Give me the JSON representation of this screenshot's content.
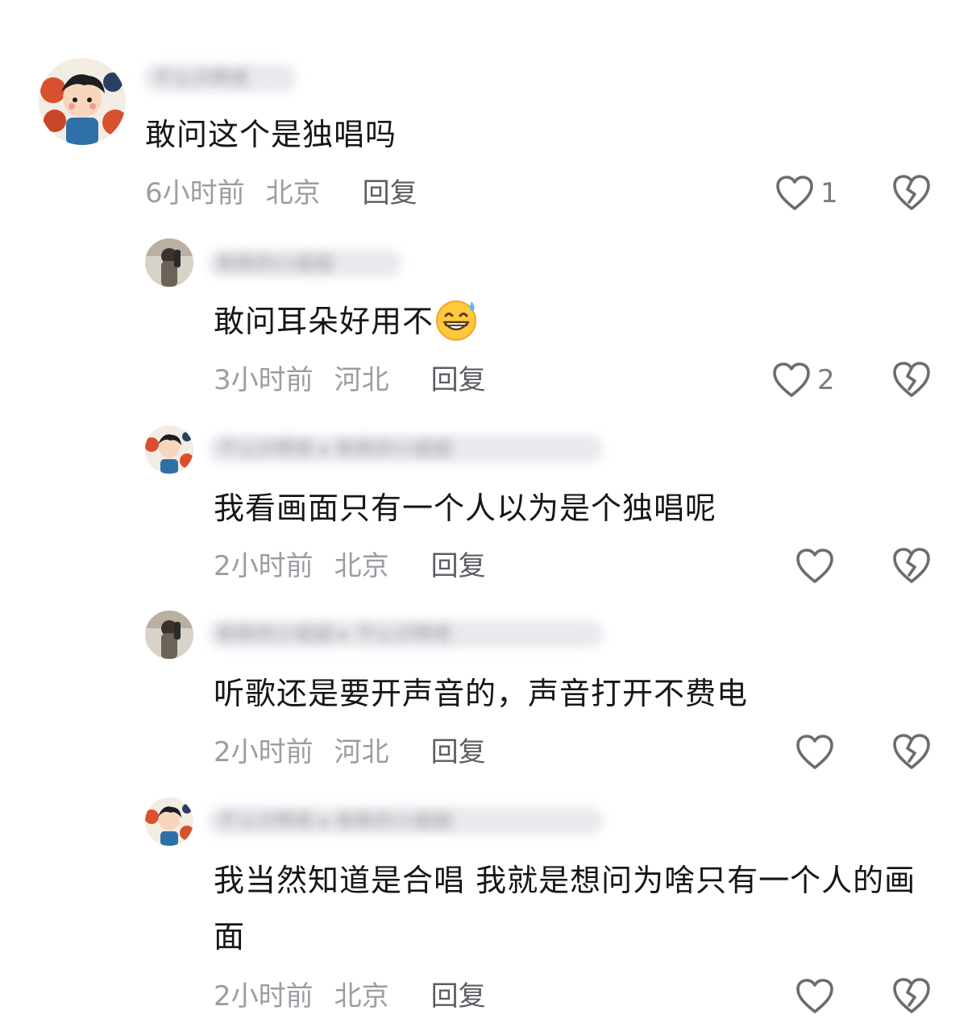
{
  "comments": [
    {
      "username": "不认识啊老",
      "text": "敢问这个是独唱吗",
      "time": "6小时前",
      "location": "北京",
      "reply_label": "回复",
      "likes": "1"
    },
    {
      "username": "新新的小姐姐",
      "text": "敢问耳朵好用不",
      "emoji": "sweat-grin-emoji",
      "time": "3小时前",
      "location": "河北",
      "reply_label": "回复",
      "likes": "2"
    },
    {
      "username": "不认识啊老 ▸ 新新的小姐姐",
      "text": "我看画面只有一个人以为是个独唱呢",
      "time": "2小时前",
      "location": "北京",
      "reply_label": "回复",
      "likes": ""
    },
    {
      "username": "新新的小姐姐 ▸ 不认识啊老",
      "text": "听歌还是要开声音的，声音打开不费电",
      "time": "2小时前",
      "location": "河北",
      "reply_label": "回复",
      "likes": ""
    },
    {
      "username": "不认识啊老 ▸ 新新的小姐姐",
      "text": "我当然知道是合唱 我就是想问为啥只有一个人的画面",
      "time": "2小时前",
      "location": "北京",
      "reply_label": "回复",
      "likes": ""
    }
  ],
  "icons": {
    "like": "heart-outline-icon",
    "dislike": "broken-heart-icon"
  },
  "colors": {
    "meta_text": "#9c9ca3",
    "reply_text": "#5c5c63",
    "icon_stroke": "#6b6b72"
  }
}
